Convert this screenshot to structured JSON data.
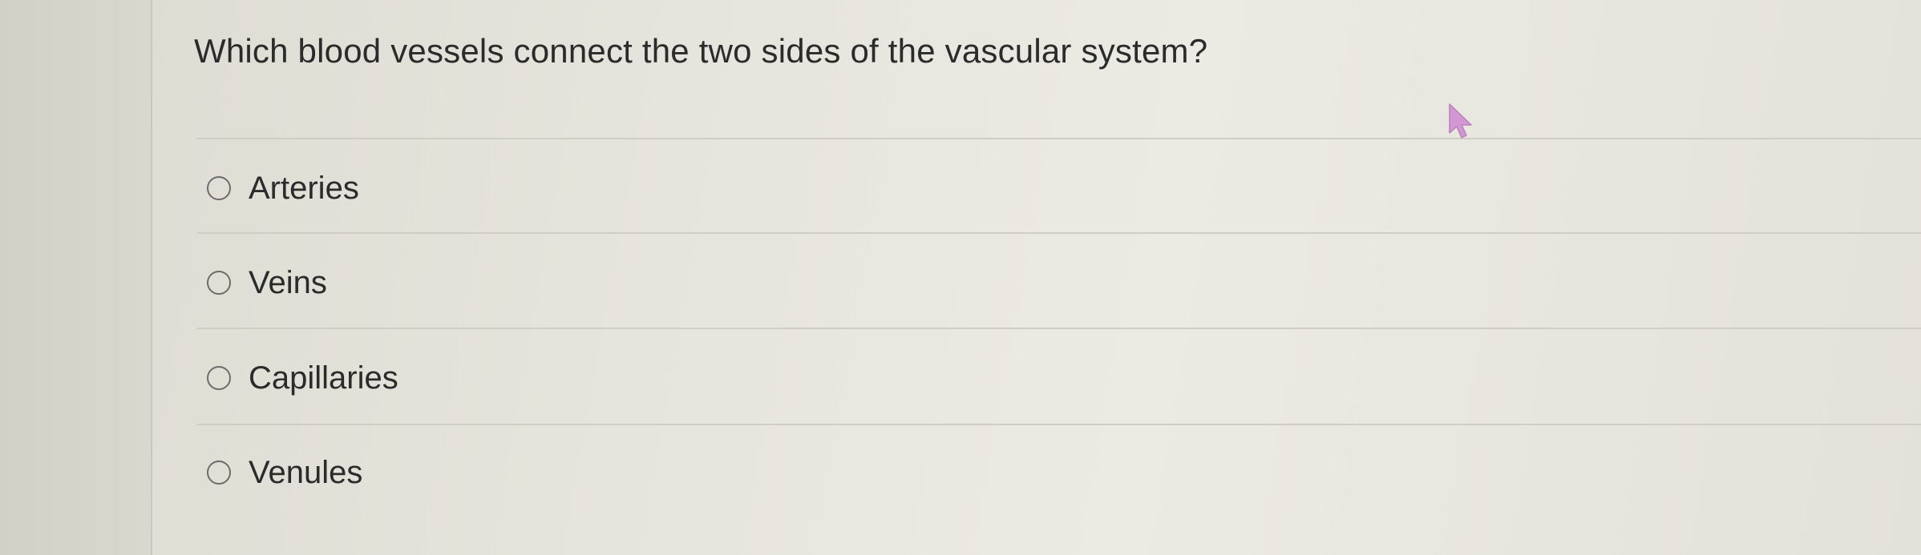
{
  "question": {
    "text": "Which blood vessels connect the two sides of the vascular system?"
  },
  "options": [
    {
      "label": "Arteries"
    },
    {
      "label": "Veins"
    },
    {
      "label": "Capillaries"
    },
    {
      "label": "Venules"
    }
  ],
  "colors": {
    "background": "#e6e5dd",
    "text": "#2b2b2b",
    "radio_border": "#6c6c6c",
    "divider": "#cfcec5",
    "cursor": "#d08bd3"
  },
  "icons": {
    "cursor": "mouse-pointer-icon",
    "radio": "radio-unselected-icon"
  }
}
